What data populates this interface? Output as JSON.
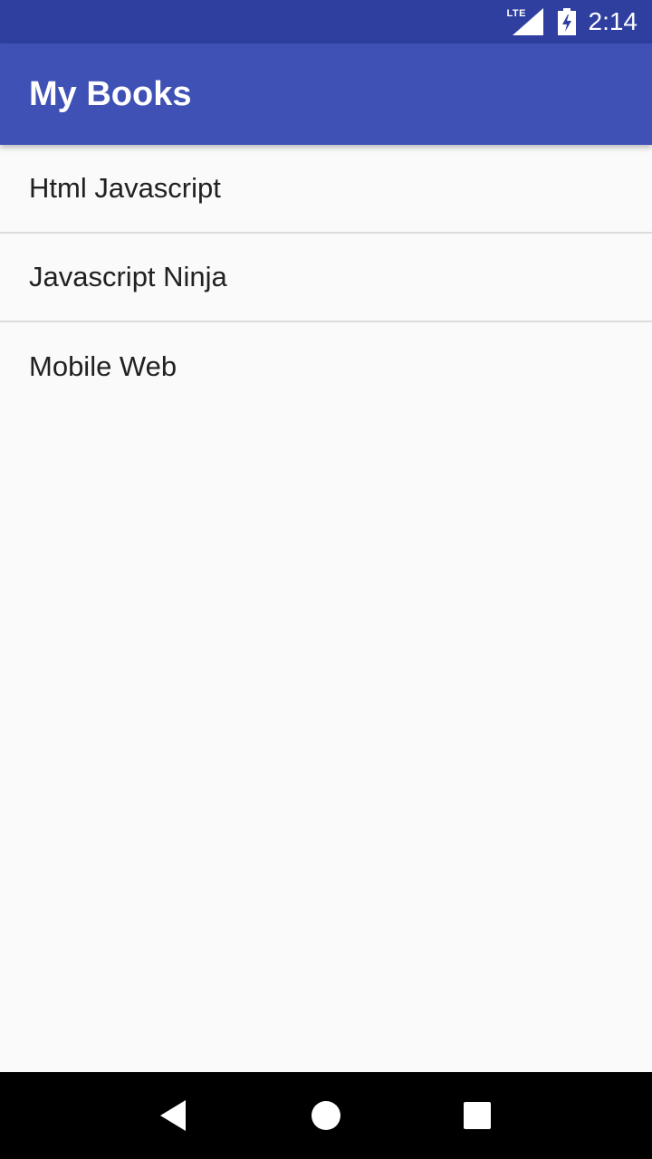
{
  "status_bar": {
    "network": "LTE",
    "time": "2:14",
    "icons": [
      "signal-icon",
      "battery-charging-icon"
    ]
  },
  "app_bar": {
    "title": "My Books"
  },
  "books": [
    {
      "title": "Html Javascript"
    },
    {
      "title": "Javascript Ninja"
    },
    {
      "title": "Mobile Web"
    }
  ],
  "nav_bar": {
    "icons": [
      "back-icon",
      "home-icon",
      "recents-icon"
    ]
  },
  "colors": {
    "status_bar": "#2f3fa0",
    "app_bar": "#3f51b5",
    "background": "#fafafa",
    "divider": "#dcdcdc",
    "text": "#212121"
  }
}
